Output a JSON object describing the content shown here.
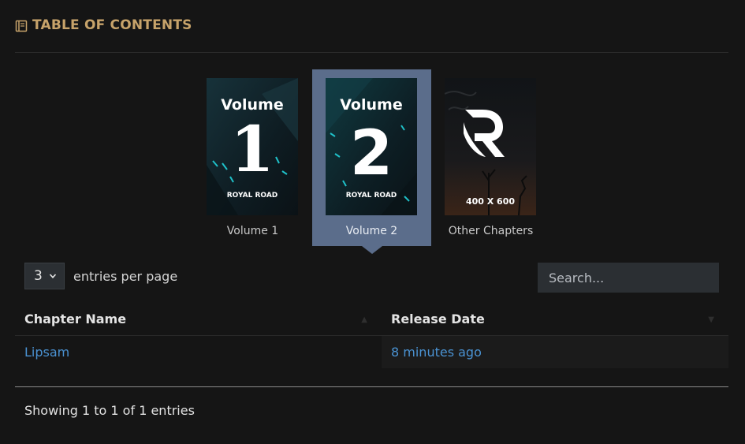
{
  "header": {
    "title": "TABLE OF CONTENTS",
    "icon": "book-icon",
    "title_color": "#c7a36a"
  },
  "volumes": [
    {
      "label": "Volume 1",
      "cover_word": "Volume",
      "cover_number": "1",
      "cover_brand": "ROYAL ROAD",
      "active": false
    },
    {
      "label": "Volume 2",
      "cover_word": "Volume",
      "cover_number": "2",
      "cover_brand": "ROYAL ROAD",
      "active": true
    },
    {
      "label": "Other Chapters",
      "cover_text": "400 X 600",
      "active": false
    }
  ],
  "length_menu": {
    "value": "3",
    "label": "entries per page"
  },
  "search": {
    "placeholder": "Search..."
  },
  "table": {
    "columns": [
      "Chapter Name",
      "Release Date"
    ],
    "rows": [
      {
        "name": "Lipsam",
        "date": "8 minutes ago"
      }
    ]
  },
  "info": "Showing 1 to 1 of 1 entries",
  "colors": {
    "accent": "#c7a36a",
    "link": "#4a92d2",
    "active_volume_bg": "#5b6d8b",
    "background": "#151515"
  }
}
